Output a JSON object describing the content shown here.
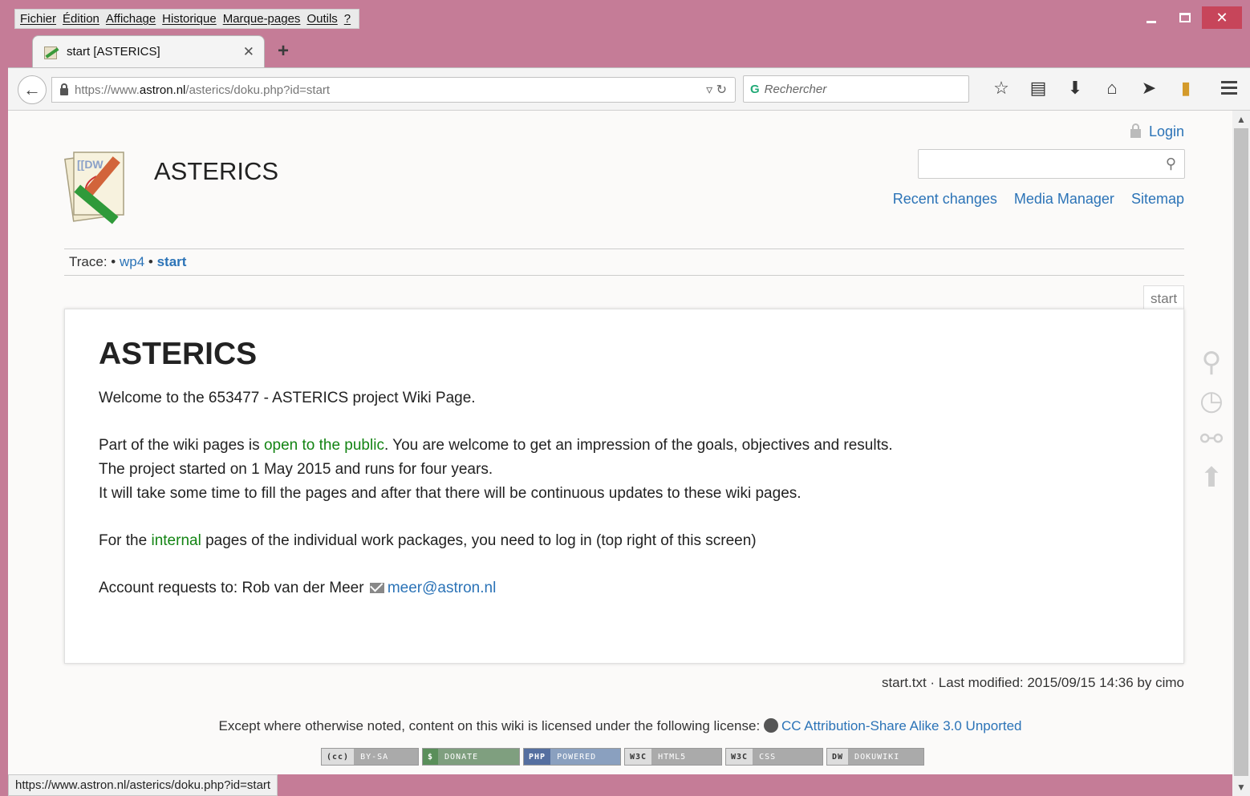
{
  "browser": {
    "menu": [
      "Fichier",
      "Édition",
      "Affichage",
      "Historique",
      "Marque-pages",
      "Outils",
      "?"
    ],
    "tab_title": "start [ASTERICS]",
    "url_prefix": "https://www.",
    "url_domain": "astron.nl",
    "url_path": "/asterics/doku.php?id=start",
    "search_placeholder": "Rechercher",
    "status_url": "https://www.astron.nl/asterics/doku.php?id=start"
  },
  "site": {
    "title": "ASTERICS",
    "login": "Login",
    "links": [
      "Recent changes",
      "Media Manager",
      "Sitemap"
    ],
    "trace_label": "Trace:",
    "trace_items": [
      "wp4",
      "start"
    ],
    "page_id": "start"
  },
  "content": {
    "heading": "ASTERICS",
    "welcome": "Welcome to the 653477 - ASTERICS project Wiki Page.",
    "p2_before": "Part of the wiki pages is ",
    "p2_link": "open to the public",
    "p2_after": ". You are welcome to get an impression of the goals, objectives and results.",
    "p3": "The project started on 1 May 2015 and runs for four years.",
    "p4": "It will take some time to fill the pages and after that there will be continuous updates to these wiki pages.",
    "p5_before": "For the ",
    "p5_link": "internal",
    "p5_after": " pages of the individual work packages, you need to log in (top right of this screen)",
    "p6_before": "Account requests to: Rob van der Meer ",
    "p6_email": "meer@astron.nl"
  },
  "footer": {
    "docinfo": "start.txt · Last modified: 2015/09/15 14:36 by cimo",
    "license_text": "Except where otherwise noted, content on this wiki is licensed under the following license:",
    "license_link": "CC Attribution-Share Alike 3.0 Unported",
    "badges": [
      {
        "k": "(cc)",
        "v": "BY-SA"
      },
      {
        "k": "$",
        "v": "DONATE"
      },
      {
        "k": "PHP",
        "v": "POWERED"
      },
      {
        "k": "W3C",
        "v": "HTML5"
      },
      {
        "k": "W3C",
        "v": "CSS"
      },
      {
        "k": "DW",
        "v": "DOKUWIKI"
      }
    ]
  },
  "colors": {
    "window_frame": "#c57c97",
    "link": "#2b73b7",
    "internal_link": "#138413"
  }
}
